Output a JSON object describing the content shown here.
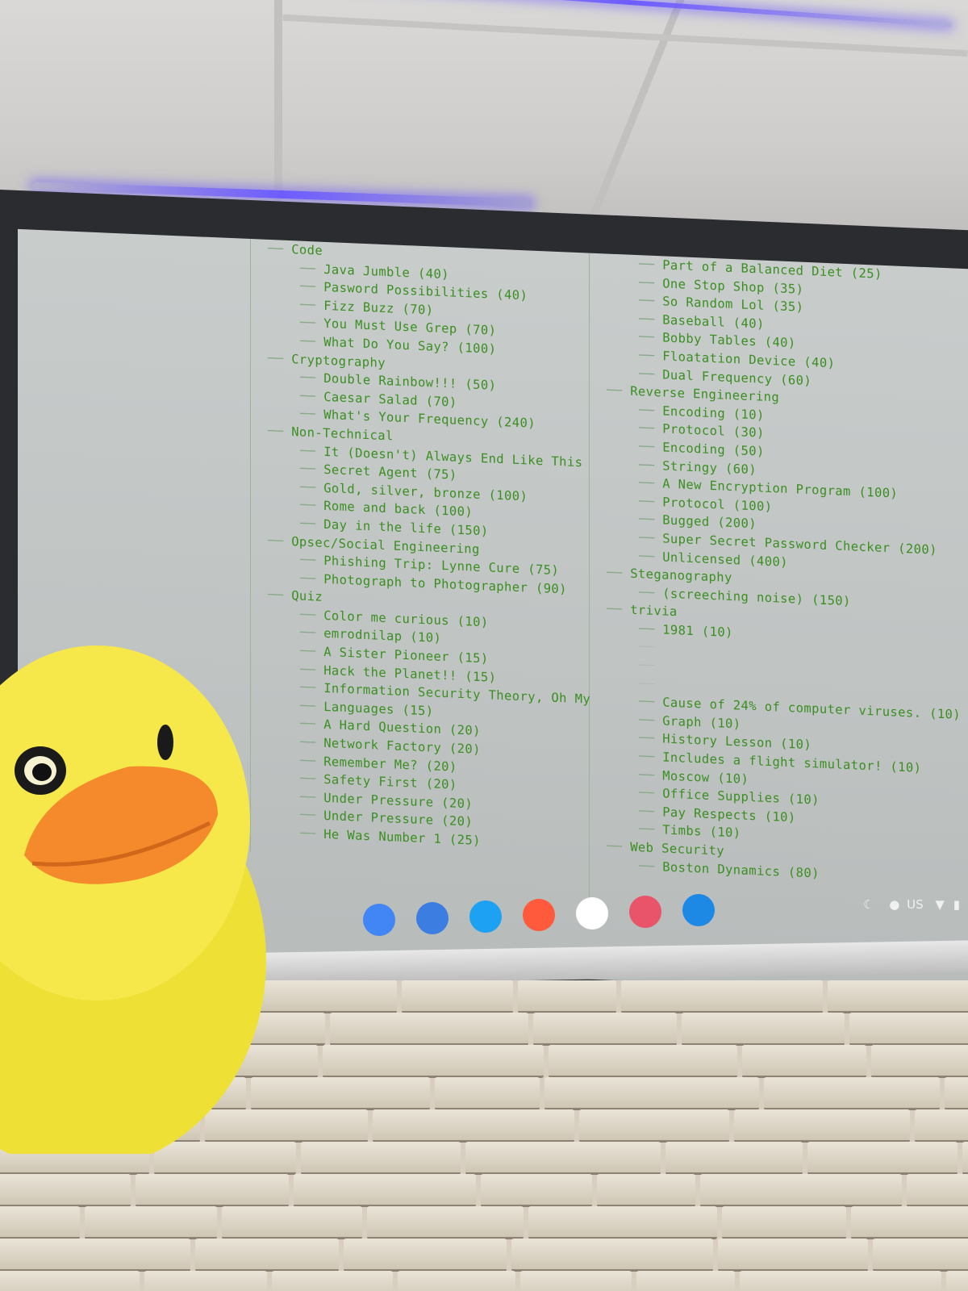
{
  "screen": {
    "left_tree": [
      {
        "level": 0,
        "text": "Code"
      },
      {
        "level": 1,
        "text": "Java Jumble (40)"
      },
      {
        "level": 1,
        "text": "Pasword Possibilities (40)"
      },
      {
        "level": 1,
        "text": "Fizz Buzz (70)"
      },
      {
        "level": 1,
        "text": "You Must Use Grep (70)"
      },
      {
        "level": 1,
        "text": "What Do You Say? (100)"
      },
      {
        "level": 0,
        "text": "Cryptography"
      },
      {
        "level": 1,
        "text": "Double Rainbow!!! (50)"
      },
      {
        "level": 1,
        "text": "Caesar Salad (70)"
      },
      {
        "level": 1,
        "text": "What's Your Frequency (240)"
      },
      {
        "level": 0,
        "text": "Non-Technical"
      },
      {
        "level": 1,
        "text": "It (Doesn't) Always End Like This"
      },
      {
        "level": 1,
        "text": "Secret Agent (75)"
      },
      {
        "level": 1,
        "text": "Gold, silver, bronze (100)"
      },
      {
        "level": 1,
        "text": "Rome and back (100)"
      },
      {
        "level": 1,
        "text": "Day in the life (150)"
      },
      {
        "level": 0,
        "text": "Opsec/Social Engineering"
      },
      {
        "level": 1,
        "text": "Phishing Trip: Lynne Cure (75)"
      },
      {
        "level": 1,
        "text": "Photograph to Photographer (90)"
      },
      {
        "level": 0,
        "text": "Quiz"
      },
      {
        "level": 1,
        "text": "Color me curious (10)"
      },
      {
        "level": 1,
        "text": "emrodnilap (10)"
      },
      {
        "level": 1,
        "text": "A Sister Pioneer (15)"
      },
      {
        "level": 1,
        "text": "Hack the Planet!! (15)"
      },
      {
        "level": 1,
        "text": "Information Security Theory, Oh My"
      },
      {
        "level": 1,
        "text": "Languages (15)"
      },
      {
        "level": 1,
        "text": "A Hard Question (20)"
      },
      {
        "level": 1,
        "text": "Network Factory (20)"
      },
      {
        "level": 1,
        "text": "Remember Me? (20)"
      },
      {
        "level": 1,
        "text": "Safety First (20)"
      },
      {
        "level": 1,
        "text": "Under Pressure (20)"
      },
      {
        "level": 1,
        "text": "Under Pressure (20)"
      },
      {
        "level": 1,
        "text": "He Was Number 1 (25)"
      }
    ],
    "right_tree": [
      {
        "level": 1,
        "text": "Part of a Balanced Diet (25)"
      },
      {
        "level": 1,
        "text": "One Stop Shop (35)"
      },
      {
        "level": 1,
        "text": "So Random Lol (35)"
      },
      {
        "level": 1,
        "text": "Baseball (40)"
      },
      {
        "level": 1,
        "text": "Bobby Tables (40)"
      },
      {
        "level": 1,
        "text": "Floatation Device (40)"
      },
      {
        "level": 1,
        "text": "Dual Frequency (60)"
      },
      {
        "level": 0,
        "text": "Reverse Engineering"
      },
      {
        "level": 1,
        "text": "Encoding (10)"
      },
      {
        "level": 1,
        "text": "Protocol (30)"
      },
      {
        "level": 1,
        "text": "Encoding (50)"
      },
      {
        "level": 1,
        "text": "Stringy (60)"
      },
      {
        "level": 1,
        "text": "A New Encryption Program (100)"
      },
      {
        "level": 1,
        "text": "Protocol (100)"
      },
      {
        "level": 1,
        "text": "Bugged (200)"
      },
      {
        "level": 1,
        "text": "Super Secret Password Checker (200)"
      },
      {
        "level": 1,
        "text": "Unlicensed (400)"
      },
      {
        "level": 0,
        "text": "Steganography"
      },
      {
        "level": 1,
        "text": "(screeching noise) (150)"
      },
      {
        "level": 0,
        "text": "trivia"
      },
      {
        "level": 1,
        "text": "1981 (10)"
      },
      {
        "level": 1,
        "text": "",
        "dim": true
      },
      {
        "level": 1,
        "text": "",
        "dim": true
      },
      {
        "level": 1,
        "text": "",
        "dim": true
      },
      {
        "level": 1,
        "text": "Cause of 24% of computer viruses. (10)"
      },
      {
        "level": 1,
        "text": "Graph (10)"
      },
      {
        "level": 1,
        "text": "History Lesson (10)"
      },
      {
        "level": 1,
        "text": "Includes a flight simulator! (10)"
      },
      {
        "level": 1,
        "text": "Moscow (10)"
      },
      {
        "level": 1,
        "text": "Office Supplies (10)"
      },
      {
        "level": 1,
        "text": "Pay Respects (10)"
      },
      {
        "level": 1,
        "text": "Timbs (10)"
      },
      {
        "level": 0,
        "text": "Web Security"
      },
      {
        "level": 1,
        "text": "Boston Dynamics (80)"
      }
    ],
    "taskbar": {
      "apps": [
        {
          "name": "chrome-icon",
          "color": "#4285f4"
        },
        {
          "name": "files-icon",
          "color": "#3b7de0"
        },
        {
          "name": "twitter-icon",
          "color": "#1da1f2"
        },
        {
          "name": "play-icon",
          "color": "#ff5a3c"
        },
        {
          "name": "notion-icon",
          "color": "#ffffff"
        },
        {
          "name": "stack-icon",
          "color": "#e9546b"
        },
        {
          "name": "screen-icon",
          "color": "#1e88e5"
        }
      ],
      "tray_text": "US"
    }
  },
  "colors": {
    "terminal_text": "#3b8f22",
    "duck_body": "#f6e84a",
    "duck_beak": "#f48a2c"
  }
}
